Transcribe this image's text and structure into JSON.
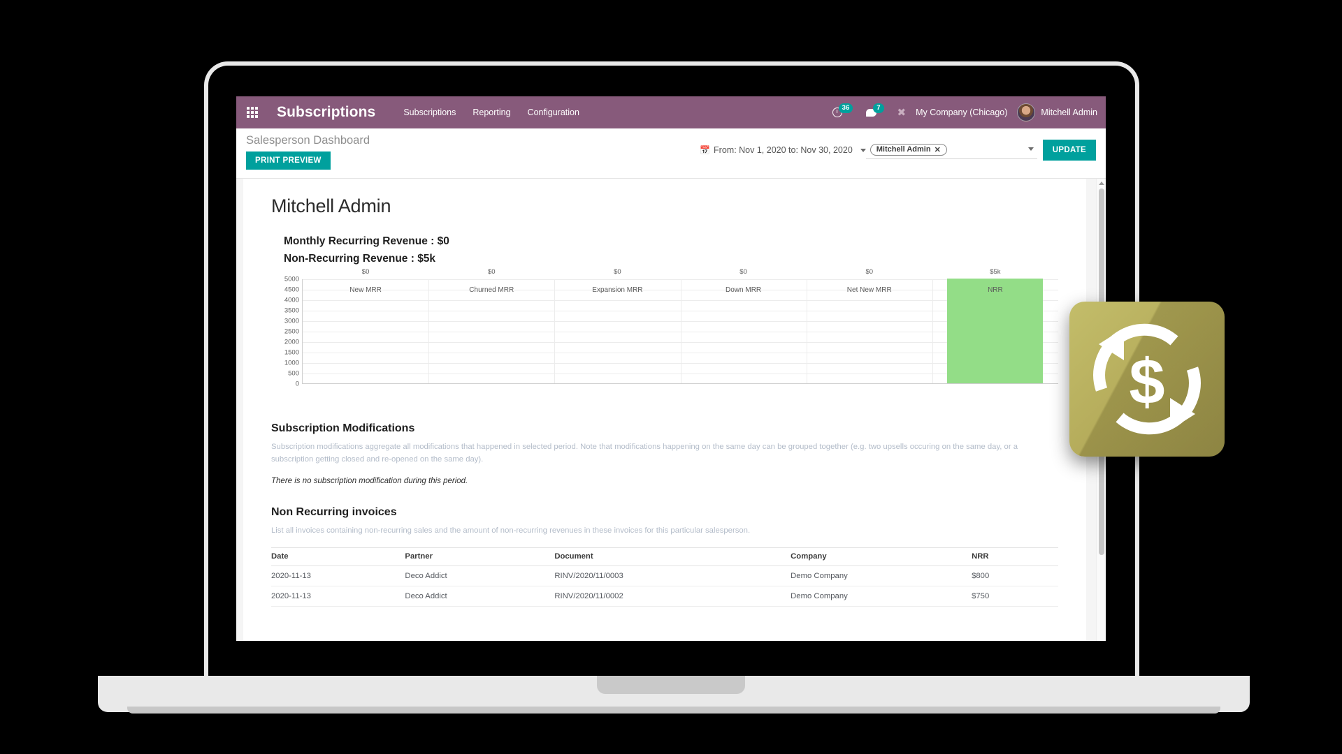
{
  "topbar": {
    "apps_icon": "apps-grid-icon",
    "app_title": "Subscriptions",
    "menu": [
      {
        "label": "Subscriptions"
      },
      {
        "label": "Reporting"
      },
      {
        "label": "Configuration"
      }
    ],
    "activities_icon": "clock-activities-icon",
    "activities_count": "36",
    "messages_icon": "chat-bubble-icon",
    "messages_count": "7",
    "debug_icon": "wrench-bug-icon",
    "company": "My Company (Chicago)",
    "user": "Mitchell Admin",
    "brand_color": "#875a7b",
    "badge_color": "#00a09d"
  },
  "control_panel": {
    "breadcrumb": "Salesperson Dashboard",
    "print_preview_label": "PRINT PREVIEW",
    "calendar_icon": "calendar-icon",
    "date_range": "From: Nov 1, 2020 to: Nov 30, 2020",
    "salesperson_tag": "Mitchell Admin",
    "tag_remove_icon": "close-x-icon",
    "dropdown_icon": "chevron-down-icon",
    "update_label": "UPDATE",
    "accent_color": "#00a09d"
  },
  "report": {
    "title": "Mitchell Admin",
    "mrr_line": "Monthly Recurring Revenue : $0",
    "nrr_line": "Non-Recurring Revenue : $5k",
    "modifications": {
      "title": "Subscription Modifications",
      "description": "Subscription modifications aggregate all modifications that happened in selected period. Note that modifications happening on the same day can be grouped together (e.g. two upsells occuring on the same day, or a subscription getting closed and re-opened on the same day).",
      "empty_note": "There is no subscription modification during this period."
    },
    "invoices": {
      "title": "Non Recurring invoices",
      "description": "List all invoices containing non-recurring sales and the amount of non-recurring revenues in these invoices for this particular salesperson.",
      "columns": [
        "Date",
        "Partner",
        "Document",
        "Company",
        "NRR"
      ],
      "rows": [
        [
          "2020-11-13",
          "Deco Addict",
          "RINV/2020/11/0003",
          "Demo Company",
          "$800"
        ],
        [
          "2020-11-13",
          "Deco Addict",
          "RINV/2020/11/0002",
          "Demo Company",
          "$750"
        ]
      ]
    }
  },
  "chart_data": {
    "type": "bar",
    "title": "",
    "xlabel": "",
    "ylabel": "",
    "categories": [
      "New MRR",
      "Churned MRR",
      "Expansion MRR",
      "Down MRR",
      "Net New MRR",
      "NRR"
    ],
    "values": [
      0,
      0,
      0,
      0,
      0,
      5000
    ],
    "data_labels": [
      "$0",
      "$0",
      "$0",
      "$0",
      "$0",
      "$5k"
    ],
    "ylim": [
      0,
      5000
    ],
    "yticks": [
      5000,
      4500,
      4000,
      3500,
      3000,
      2500,
      2000,
      1500,
      1000,
      500,
      0
    ],
    "bar_color": "#93dd87",
    "grid": true,
    "legend": false
  },
  "app_icon": {
    "name": "subscriptions-app-icon",
    "glyph": "recurring-dollar-icon",
    "background_color": "#b6ad5c"
  },
  "scrollbar": {
    "up_arrow_icon": "scroll-up-arrow-icon"
  }
}
